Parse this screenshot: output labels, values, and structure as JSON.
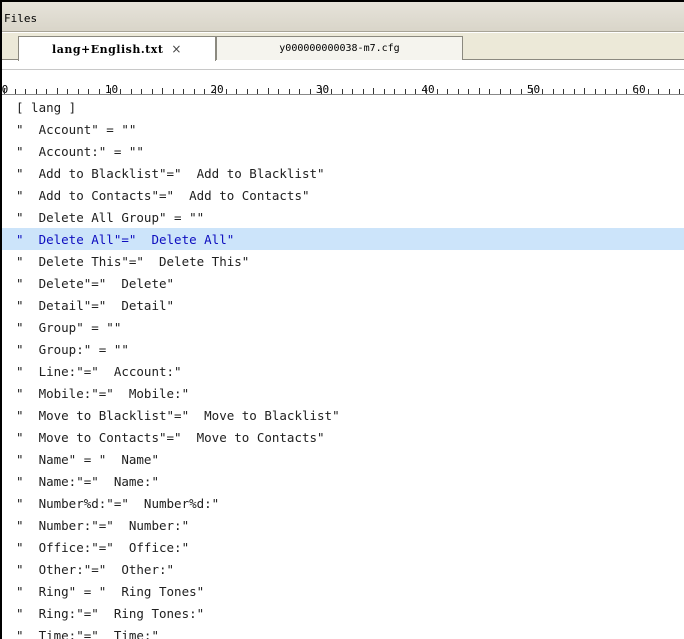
{
  "panel": {
    "title": "Files"
  },
  "tabs": [
    {
      "label": "lang+English.txt",
      "close": "×",
      "active": true
    },
    {
      "label": "y000000000038-m7.cfg",
      "active": false
    }
  ],
  "ruler": {
    "labels": [
      "0",
      "10",
      "20",
      "30",
      "40",
      "50",
      "60"
    ]
  },
  "editor": {
    "highlight_line": 7,
    "lines": [
      "[ lang ]",
      "\"  Account\" = \"\"",
      "\"  Account:\" = \"\"",
      "\"  Add to Blacklist\"=\"  Add to Blacklist\"",
      "\"  Add to Contacts\"=\"  Add to Contacts\"",
      "\"  Delete All Group\" = \"\"",
      "\"  Delete All\"=\"  Delete All\"",
      "\"  Delete This\"=\"  Delete This\"",
      "\"  Delete\"=\"  Delete\"",
      "\"  Detail\"=\"  Detail\"",
      "\"  Group\" = \"\"",
      "\"  Group:\" = \"\"",
      "\"  Line:\"=\"  Account:\"",
      "\"  Mobile:\"=\"  Mobile:\"",
      "\"  Move to Blacklist\"=\"  Move to Blacklist\"",
      "\"  Move to Contacts\"=\"  Move to Contacts\"",
      "\"  Name\" = \"  Name\"",
      "\"  Name:\"=\"  Name:\"",
      "\"  Number%d:\"=\"  Number%d:\"",
      "\"  Number:\"=\"  Number:\"",
      "\"  Office:\"=\"  Office:\"",
      "\"  Other:\"=\"  Other:\"",
      "\"  Ring\" = \"  Ring Tones\"",
      "\"  Ring:\"=\"  Ring Tones:\"",
      "\"  Time:\"=\"  Time:\""
    ]
  }
}
